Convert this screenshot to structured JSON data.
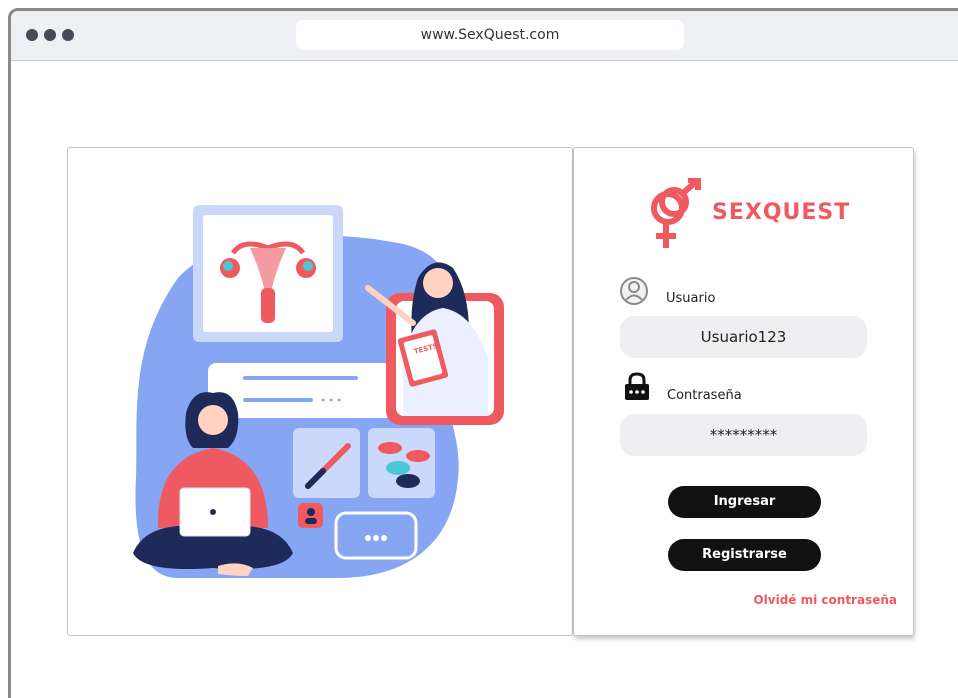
{
  "browser": {
    "url": "www.SexQuest.com"
  },
  "brand": {
    "name": "SEXQUEST",
    "accent_color": "#ef5a60"
  },
  "illustration": {
    "tests_label": "TESTS"
  },
  "login": {
    "user_icon": "user-circle-icon",
    "username_label": "Usuario",
    "username_value": "Usuario123",
    "lock_icon": "lock-icon",
    "password_label": "Contraseña",
    "password_value": "*********",
    "login_button": "Ingresar",
    "register_button": "Registrarse",
    "forgot_link": "Olvidé mi contraseña"
  }
}
